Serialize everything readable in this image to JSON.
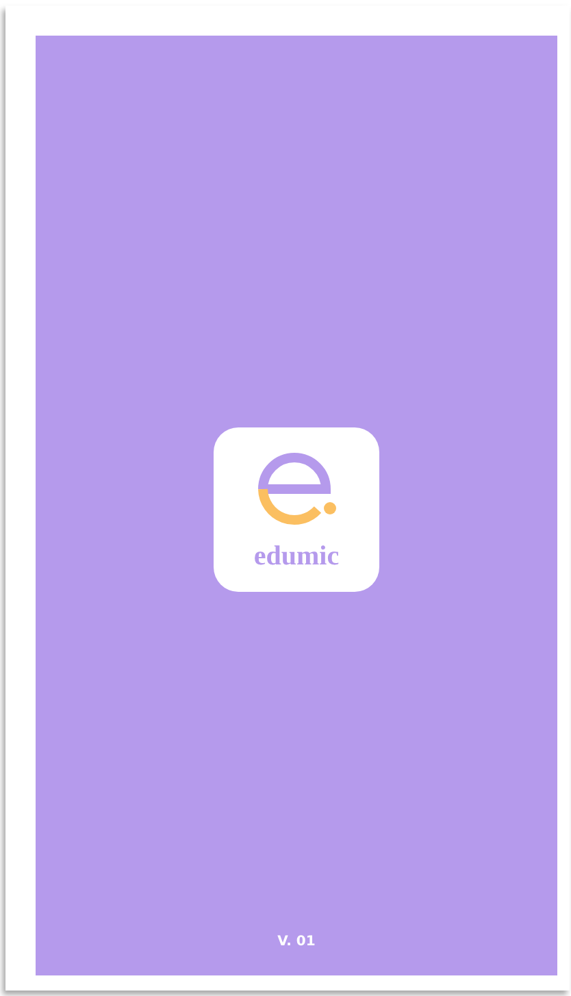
{
  "app": {
    "logo_text": "edumic",
    "version": "V. 01"
  }
}
